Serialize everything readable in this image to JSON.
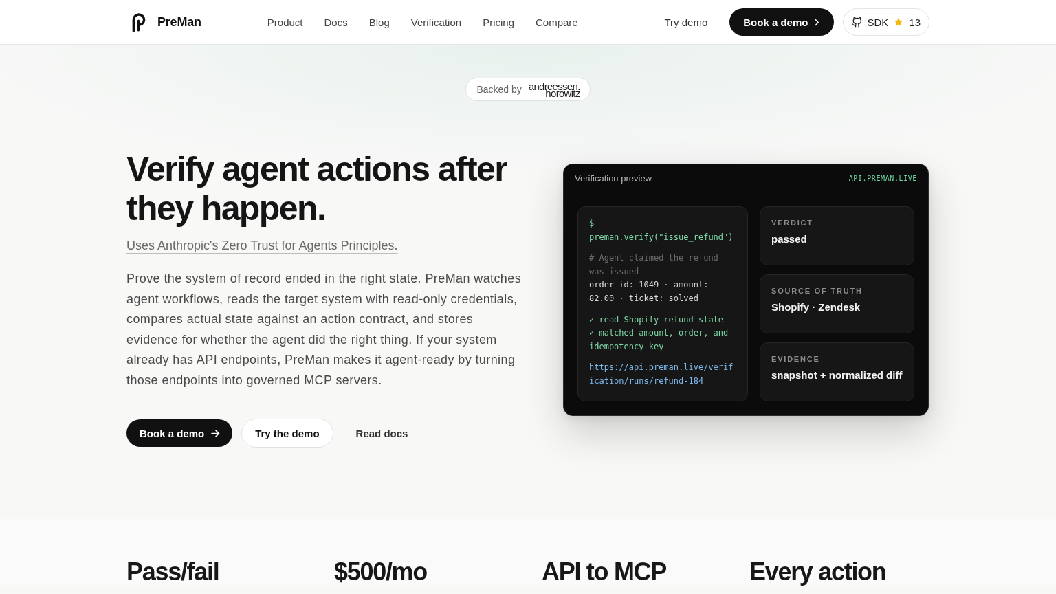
{
  "header": {
    "brand": "PreMan",
    "nav": [
      "Product",
      "Docs",
      "Blog",
      "Verification",
      "Pricing",
      "Compare"
    ],
    "try_demo": "Try demo",
    "book_demo": "Book a demo",
    "sdk": {
      "label": "SDK",
      "star_count": "13"
    }
  },
  "badge": {
    "label": "Backed by",
    "backer": [
      "andreessen.",
      "horowitz"
    ]
  },
  "hero": {
    "title": "Verify agent actions after they happen.",
    "subtitle_link": "Uses Anthropic's Zero Trust for Agents Principles.",
    "description": "Prove the system of record ended in the right state. PreMan watches agent workflows, reads the target system with read-only credentials, compares actual state against an action contract, and stores evidence for whether the agent did the right thing. If your system already has API endpoints, PreMan makes it agent-ready by turning those endpoints into governed MCP servers.",
    "buttons": [
      {
        "label": "Book a demo",
        "kind": "primary"
      },
      {
        "label": "Try the demo",
        "kind": "secondary"
      },
      {
        "label": "Read docs",
        "kind": "ghost"
      }
    ]
  },
  "preview": {
    "title": "Verification preview",
    "host": "API.PREMAN.LIVE",
    "code_blocks": [
      {
        "lines": [
          {
            "kind": "command",
            "text": "$ preman.verify(\"issue_refund\")"
          }
        ]
      },
      {
        "lines": [
          {
            "kind": "comment",
            "text": "# Agent claimed the refund was issued"
          },
          {
            "kind": "output",
            "text": "order_id: 1049 · amount: 82.00 · ticket: solved"
          }
        ]
      },
      {
        "lines": [
          {
            "kind": "check",
            "text": "✓ read Shopify refund state"
          },
          {
            "kind": "check",
            "text": "✓ matched amount, order, and idempotency key"
          }
        ]
      },
      {
        "lines": [
          {
            "kind": "link",
            "text": "https://api.preman.live/verification/runs/refund-184"
          }
        ]
      }
    ],
    "cards": [
      {
        "label": "VERDICT",
        "value": "passed"
      },
      {
        "label": "SOURCE OF TRUTH",
        "value": "Shopify · Zendesk"
      },
      {
        "label": "EVIDENCE",
        "value": "snapshot + normalized diff"
      }
    ]
  },
  "stats": [
    "Pass/fail",
    "$500/mo",
    "API to MCP",
    "Every action"
  ]
}
